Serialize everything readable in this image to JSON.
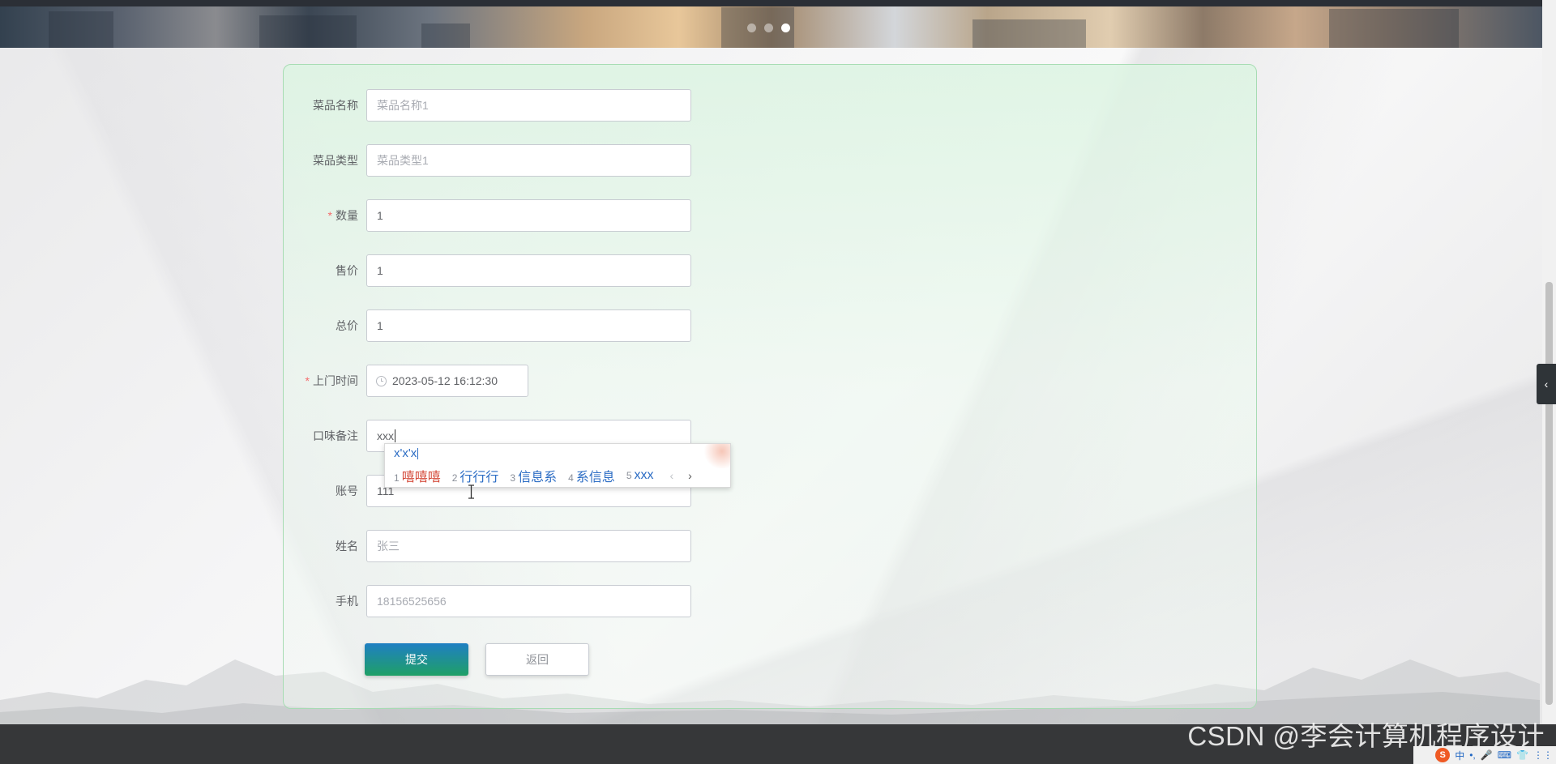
{
  "banner": {
    "slide_count": 3,
    "active_slide": 3
  },
  "form": {
    "fields": [
      {
        "label": "菜品名称",
        "required": false,
        "value": "",
        "placeholder": "菜品名称1"
      },
      {
        "label": "菜品类型",
        "required": false,
        "value": "",
        "placeholder": "菜品类型1"
      },
      {
        "label": "数量",
        "required": true,
        "value": "1",
        "placeholder": ""
      },
      {
        "label": "售价",
        "required": false,
        "value": "1",
        "placeholder": ""
      },
      {
        "label": "总价",
        "required": false,
        "value": "1",
        "placeholder": ""
      },
      {
        "label": "上门时间",
        "required": true,
        "value": "2023-05-12 16:12:30",
        "placeholder": ""
      },
      {
        "label": "口味备注",
        "required": false,
        "value": "xxx",
        "placeholder": ""
      },
      {
        "label": "账号",
        "required": false,
        "value": "111",
        "placeholder": ""
      },
      {
        "label": "姓名",
        "required": false,
        "value": "",
        "placeholder": "张三"
      },
      {
        "label": "手机",
        "required": false,
        "value": "",
        "placeholder": "18156525656"
      }
    ],
    "submit_label": "提交",
    "back_label": "返回"
  },
  "ime": {
    "composition": "x'x'x",
    "candidates": [
      {
        "num": "1",
        "text": "嘻嘻嘻"
      },
      {
        "num": "2",
        "text": "行行行"
      },
      {
        "num": "3",
        "text": "信息系"
      },
      {
        "num": "4",
        "text": "系信息"
      },
      {
        "num": "5",
        "text": "xxx"
      }
    ],
    "prev": "‹",
    "next": "›"
  },
  "side_toggle": "‹",
  "watermark": "CSDN @李会计算机程序设计",
  "tray": {
    "logo": "S",
    "items": [
      "中",
      "•,",
      "🎤",
      "⌨",
      "👕",
      "⋮⋮"
    ]
  },
  "colors": {
    "accent_gradient_start": "#1f7fc3",
    "accent_gradient_end": "#1fa066",
    "required": "#f56c6c",
    "card_border": "#a7dcb3"
  }
}
